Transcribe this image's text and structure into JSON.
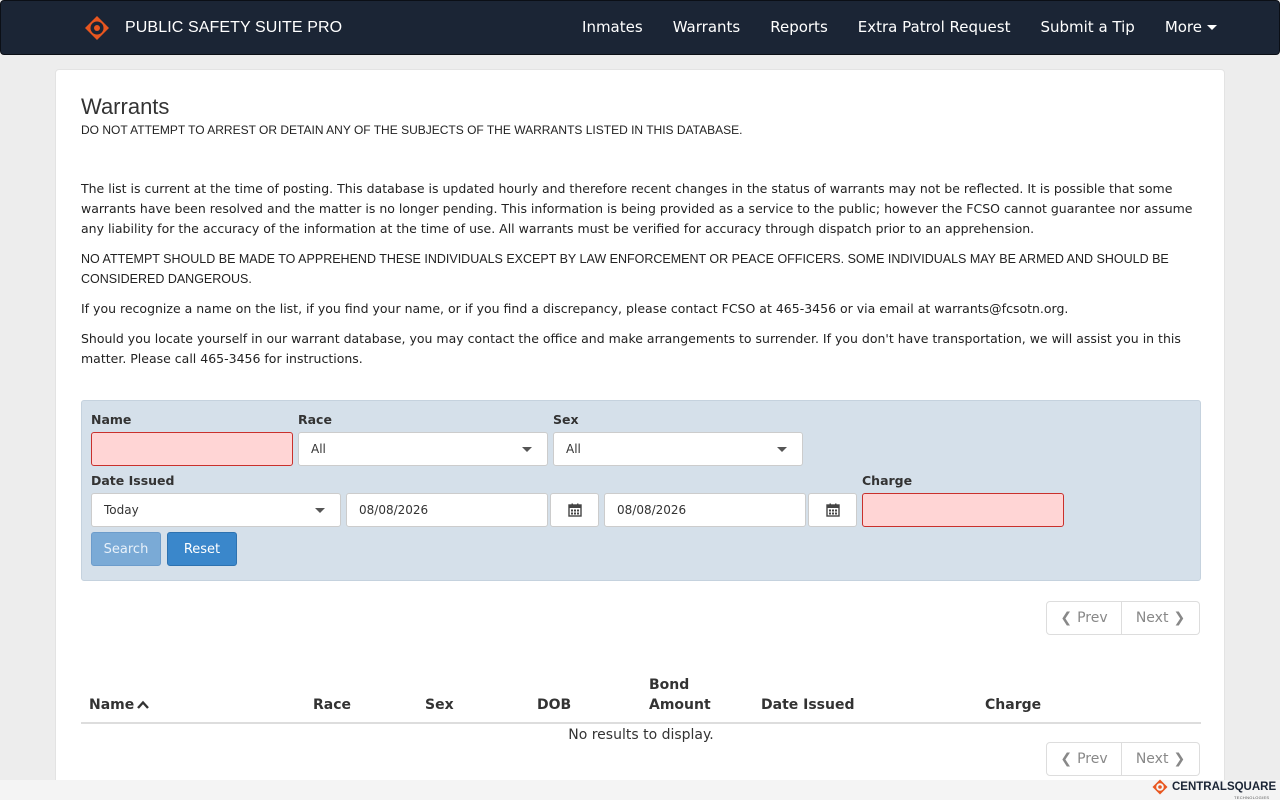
{
  "navbar": {
    "brand": "PUBLIC SAFETY SUITE PRO",
    "links": [
      "Inmates",
      "Warrants",
      "Reports",
      "Extra Patrol Request",
      "Submit a Tip"
    ],
    "more_label": "More"
  },
  "page": {
    "title": "Warrants",
    "subtitle": "DO NOT ATTEMPT TO ARREST OR DETAIN ANY OF THE SUBJECTS OF THE WARRANTS LISTED IN THIS DATABASE.",
    "paragraphs": [
      "The list is current at the time of posting. This database is updated hourly and therefore recent changes in the status of warrants may not be reflected. It is possible that some warrants have been resolved and the matter is no longer pending. This information is being provided as a service to the public; however the FCSO cannot guarantee nor assume any liability for the accuracy of the information at the time of use. All warrants must be verified for accuracy through dispatch prior to an apprehension.",
      "NO ATTEMPT SHOULD BE MADE TO APPREHEND THESE INDIVIDUALS EXCEPT BY LAW ENFORCEMENT OR PEACE OFFICERS. SOME INDIVIDUALS MAY BE ARMED AND SHOULD BE CONSIDERED DANGEROUS.",
      "If you recognize a name on the list, if you find your name, or if you find a discrepancy, please contact FCSO at 465-3456 or via email at warrants@fcsotn.org.",
      "Should you locate yourself in our warrant database, you may contact the office and make arrangements to surrender. If you don't have transportation, we will assist you in this matter. Please call 465-3456 for instructions."
    ]
  },
  "search": {
    "name_label": "Name",
    "name_value": "",
    "race_label": "Race",
    "race_value": "All",
    "sex_label": "Sex",
    "sex_value": "All",
    "date_issued_label": "Date Issued",
    "date_issued_value": "Today",
    "date_from": "08/08/2026",
    "date_to": "08/08/2026",
    "charge_label": "Charge",
    "charge_value": "",
    "search_button": "Search",
    "reset_button": "Reset"
  },
  "pagination": {
    "prev": "Prev",
    "next": "Next"
  },
  "table": {
    "columns": [
      "Name",
      "Race",
      "Sex",
      "DOB",
      "Bond Amount",
      "Date Issued",
      "Charge"
    ],
    "empty_message": "No results to display."
  },
  "footer": {
    "logo_text": "CENTRALSQUARE",
    "logo_sub": "TECHNOLOGIES"
  },
  "colors": {
    "navbar_bg": "#1b2535",
    "brand_orange": "#e8561f",
    "form_bg": "#d5e0ea",
    "invalid_bg": "#ffd5d5",
    "reset_btn": "#3a87cb"
  }
}
